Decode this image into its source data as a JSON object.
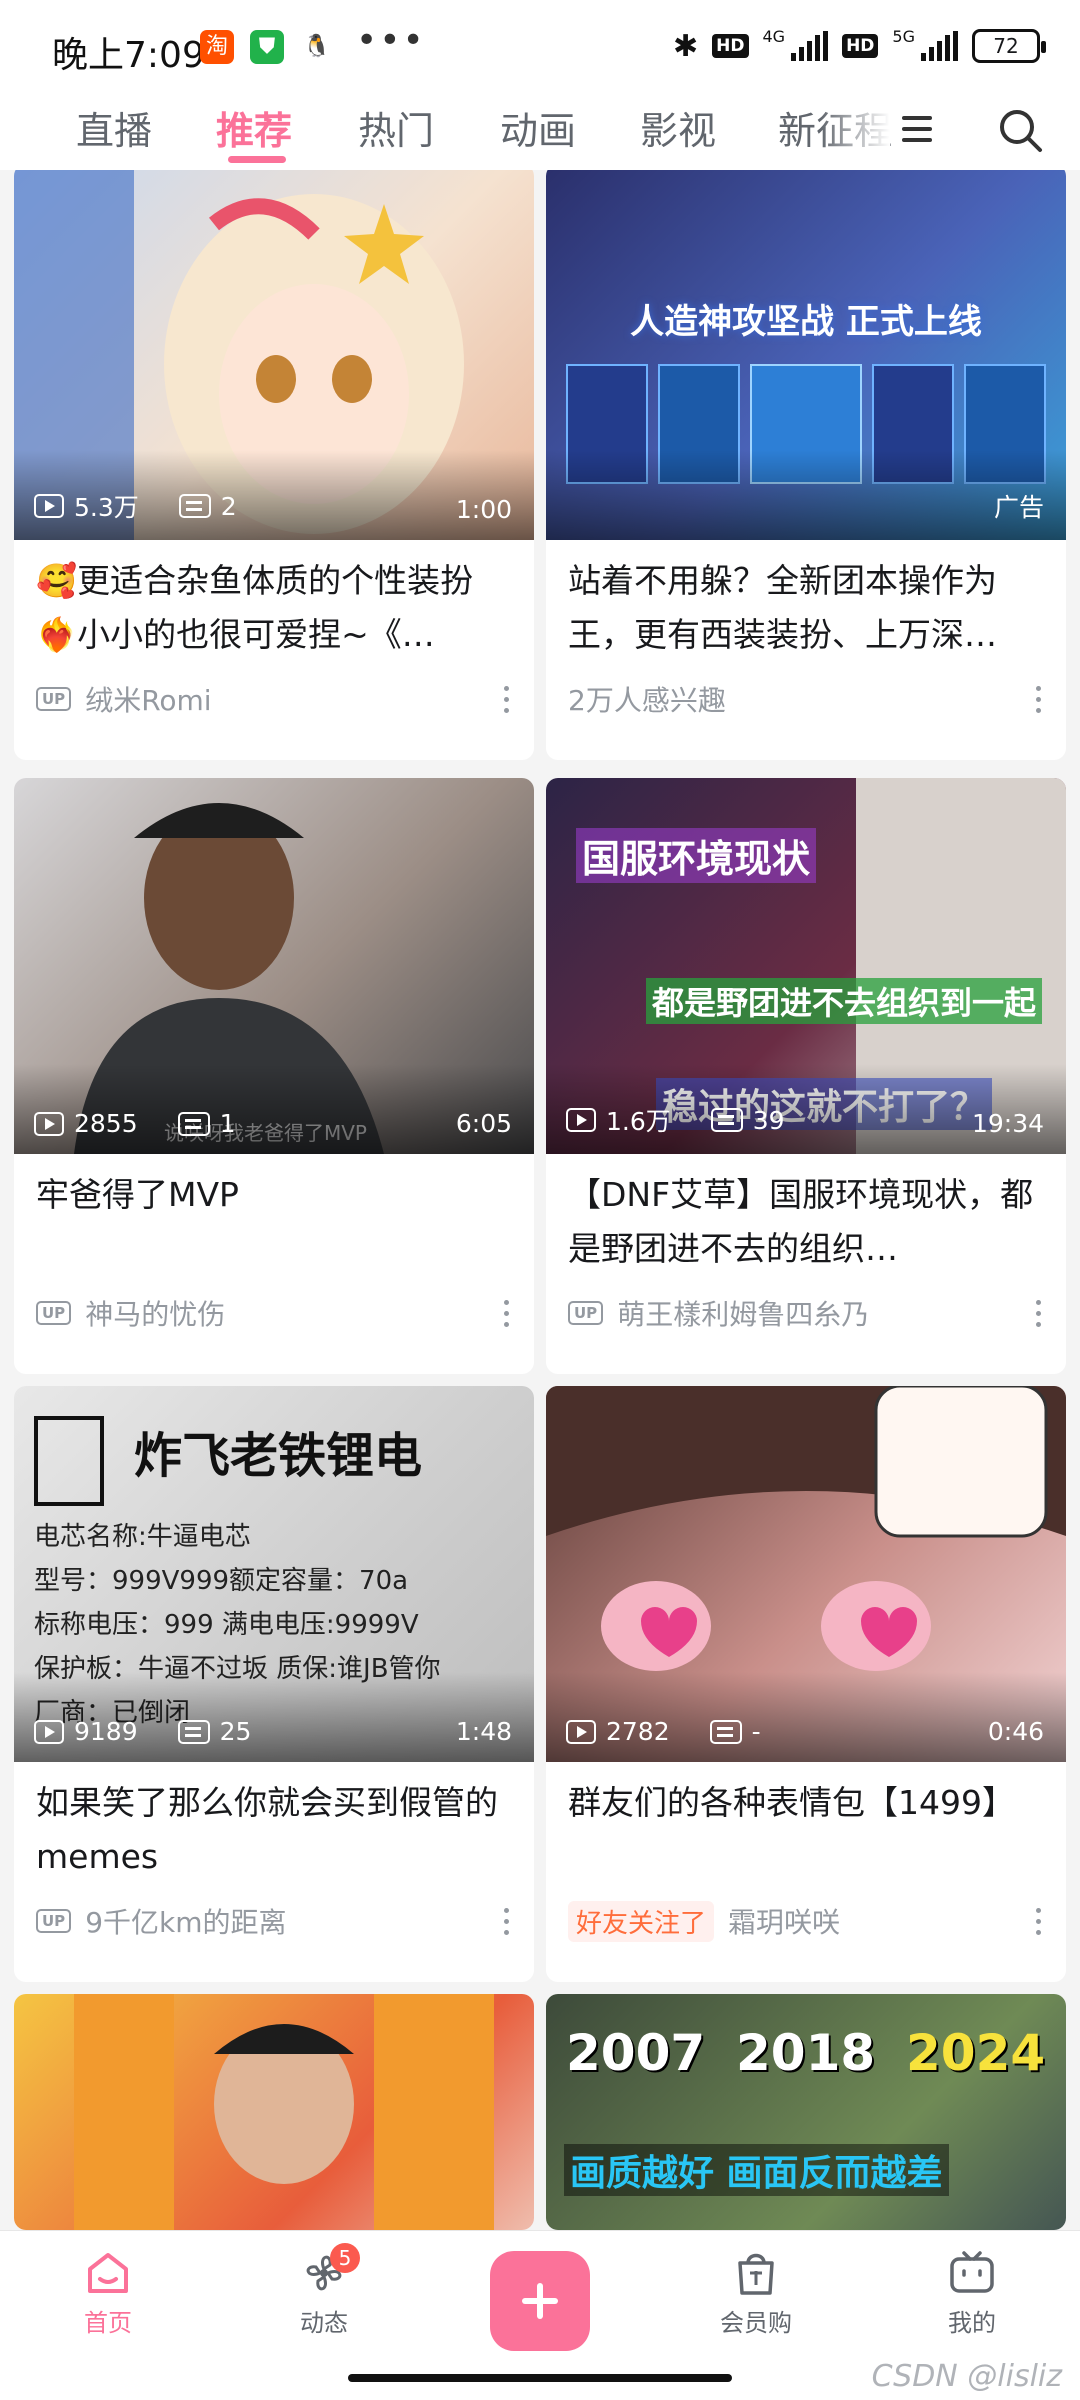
{
  "status_bar": {
    "time": "晚上7:09",
    "apps": [
      "taobao-icon",
      "shield-icon",
      "qq-icon"
    ],
    "more": "•••",
    "hd_tag": "HD",
    "net1": "4G",
    "net2": "5G",
    "battery": "72"
  },
  "top_nav": {
    "tabs": [
      "直播",
      "推荐",
      "热门",
      "动画",
      "影视",
      "新征程"
    ],
    "active_index": 1
  },
  "feed": [
    {
      "views": "5.3万",
      "danmaku": "2",
      "duration": "1:00",
      "title": "🥰更适合杂鱼体质的个性装扮❤️‍🔥小小的也很可爱捏~《…",
      "author": "绒米Romi",
      "meta_type": "up",
      "thumb_colors": [
        "#c9d8ee",
        "#f5e2d0",
        "#e8b79b"
      ]
    },
    {
      "views": "",
      "danmaku": "",
      "duration": "",
      "ad_label": "广告",
      "title": "站着不用躲？全新团本操作为王，更有西装装扮、上万深…",
      "author": "2万人感兴趣",
      "meta_type": "interest",
      "thumb_colors": [
        "#2a2f6b",
        "#4a63b8",
        "#3aa0d8"
      ]
    },
    {
      "views": "2855",
      "danmaku": "1",
      "duration": "6:05",
      "title": "牢爸得了MVP",
      "author": "神马的忧伤",
      "meta_type": "up",
      "thumb_colors": [
        "#d7d6d8",
        "#9c8e86",
        "#4a4a4c"
      ]
    },
    {
      "views": "1.6万",
      "danmaku": "39",
      "duration": "19:34",
      "title": "【DNF艾草】国服环境现状，都是野团进不去的组织…",
      "author": "萌王樣利姆鲁四糸乃",
      "meta_type": "up",
      "thumb_colors": [
        "#2c2446",
        "#6a2c44",
        "#cfc7c4"
      ]
    },
    {
      "views": "9189",
      "danmaku": "25",
      "duration": "1:48",
      "title": "如果笑了那么你就会买到假管的memes",
      "author": "9千亿km的距离",
      "meta_type": "up",
      "thumb_colors": [
        "#e8e8e8",
        "#cfcfcf",
        "#bdbdbd"
      ]
    },
    {
      "views": "2782",
      "danmaku": "-",
      "duration": "0:46",
      "title": "群友们的各种表情包【1499】",
      "author": "霜玥咲咲",
      "meta_type": "friend",
      "friend_label": "好友关注了",
      "thumb_colors": [
        "#5b3a35",
        "#c98f8a",
        "#f2d3d3"
      ]
    },
    {
      "views": "",
      "danmaku": "",
      "duration": "",
      "title": "",
      "author": "",
      "meta_type": "none",
      "thumb_colors": [
        "#f5c542",
        "#e85d3b",
        "#f3f0ea"
      ]
    },
    {
      "views": "",
      "danmaku": "",
      "duration": "",
      "title": "",
      "author": "",
      "meta_type": "none",
      "thumb_colors": [
        "#3d4a3a",
        "#6f8a55",
        "#2f3b52"
      ]
    }
  ],
  "thumb_overlays": {
    "ad_title": "人造神攻坚战 正式上线",
    "mvp_caption": "说咲呀我老爸得了MVP",
    "dnf_1": "国服环境现状",
    "dnf_2": "都是野团进不去组织到一起",
    "dnf_3": "稳过的这就不打了？",
    "sign_title": "炸飞老铁锂电",
    "sign_lines": [
      "电芯名称:牛逼电芯",
      "型号：999V999额定容量：70a",
      "标称电压：999 满电电压:9999V",
      "保护板：牛逼不过坂  质保:谁JB管你",
      "厂商：已倒闭"
    ],
    "years": [
      "2007",
      "2018",
      "2024"
    ],
    "years_caption": "画质越好 画面反而越差"
  },
  "bottom_nav": {
    "items": [
      "首页",
      "动态",
      "会员购",
      "我的"
    ],
    "badge": "5",
    "active_index": 0
  },
  "watermark": "CSDN @lisliz",
  "colors": {
    "accent": "#fb7299",
    "text": "#18191c",
    "muted": "#9499a0",
    "background": "#f4f4f4"
  }
}
